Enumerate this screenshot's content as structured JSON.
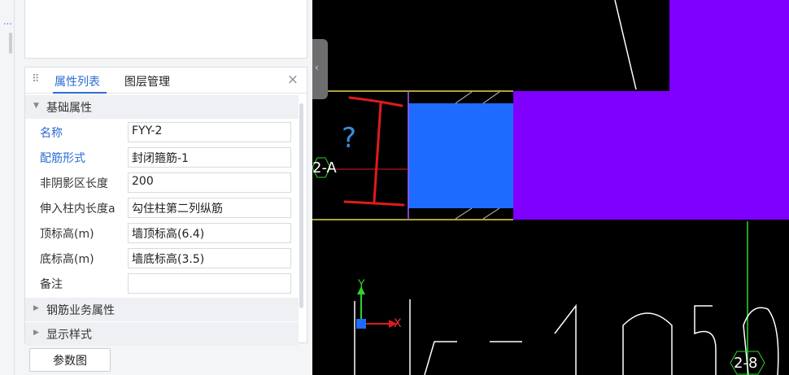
{
  "tabs": {
    "properties": "属性列表",
    "layers": "图层管理",
    "close_icon": "×"
  },
  "sections": {
    "basic": "基础属性",
    "rebar_business": "钢筋业务属性",
    "display_style": "显示样式"
  },
  "properties": [
    {
      "key": "名称",
      "value": "FYY-2",
      "highlight": true
    },
    {
      "key": "配筋形式",
      "value": "封闭箍筋-1",
      "highlight": true
    },
    {
      "key": "非阴影区长度",
      "value": "200",
      "highlight": false
    },
    {
      "key": "伸入柱内长度a",
      "value": "勾住柱第二列纵筋",
      "highlight": false
    },
    {
      "key": "顶标高(m)",
      "value": "墙顶标高(6.4)",
      "highlight": false
    },
    {
      "key": "底标高(m)",
      "value": "墙底标高(3.5)",
      "highlight": false
    },
    {
      "key": "备注",
      "value": "",
      "highlight": false
    }
  ],
  "param_button": "参数图",
  "cad": {
    "question_mark": "?",
    "axis_label_a": "2-A",
    "axis_label_8": "2-8",
    "ucs_x": "X",
    "ucs_y": "Y",
    "colors": {
      "purple": "#7f00ff",
      "blue": "#1e6cff",
      "yellow": "#e8d84a",
      "green": "#2fd22f",
      "red": "#e01b1b",
      "white": "#ffffff"
    }
  }
}
